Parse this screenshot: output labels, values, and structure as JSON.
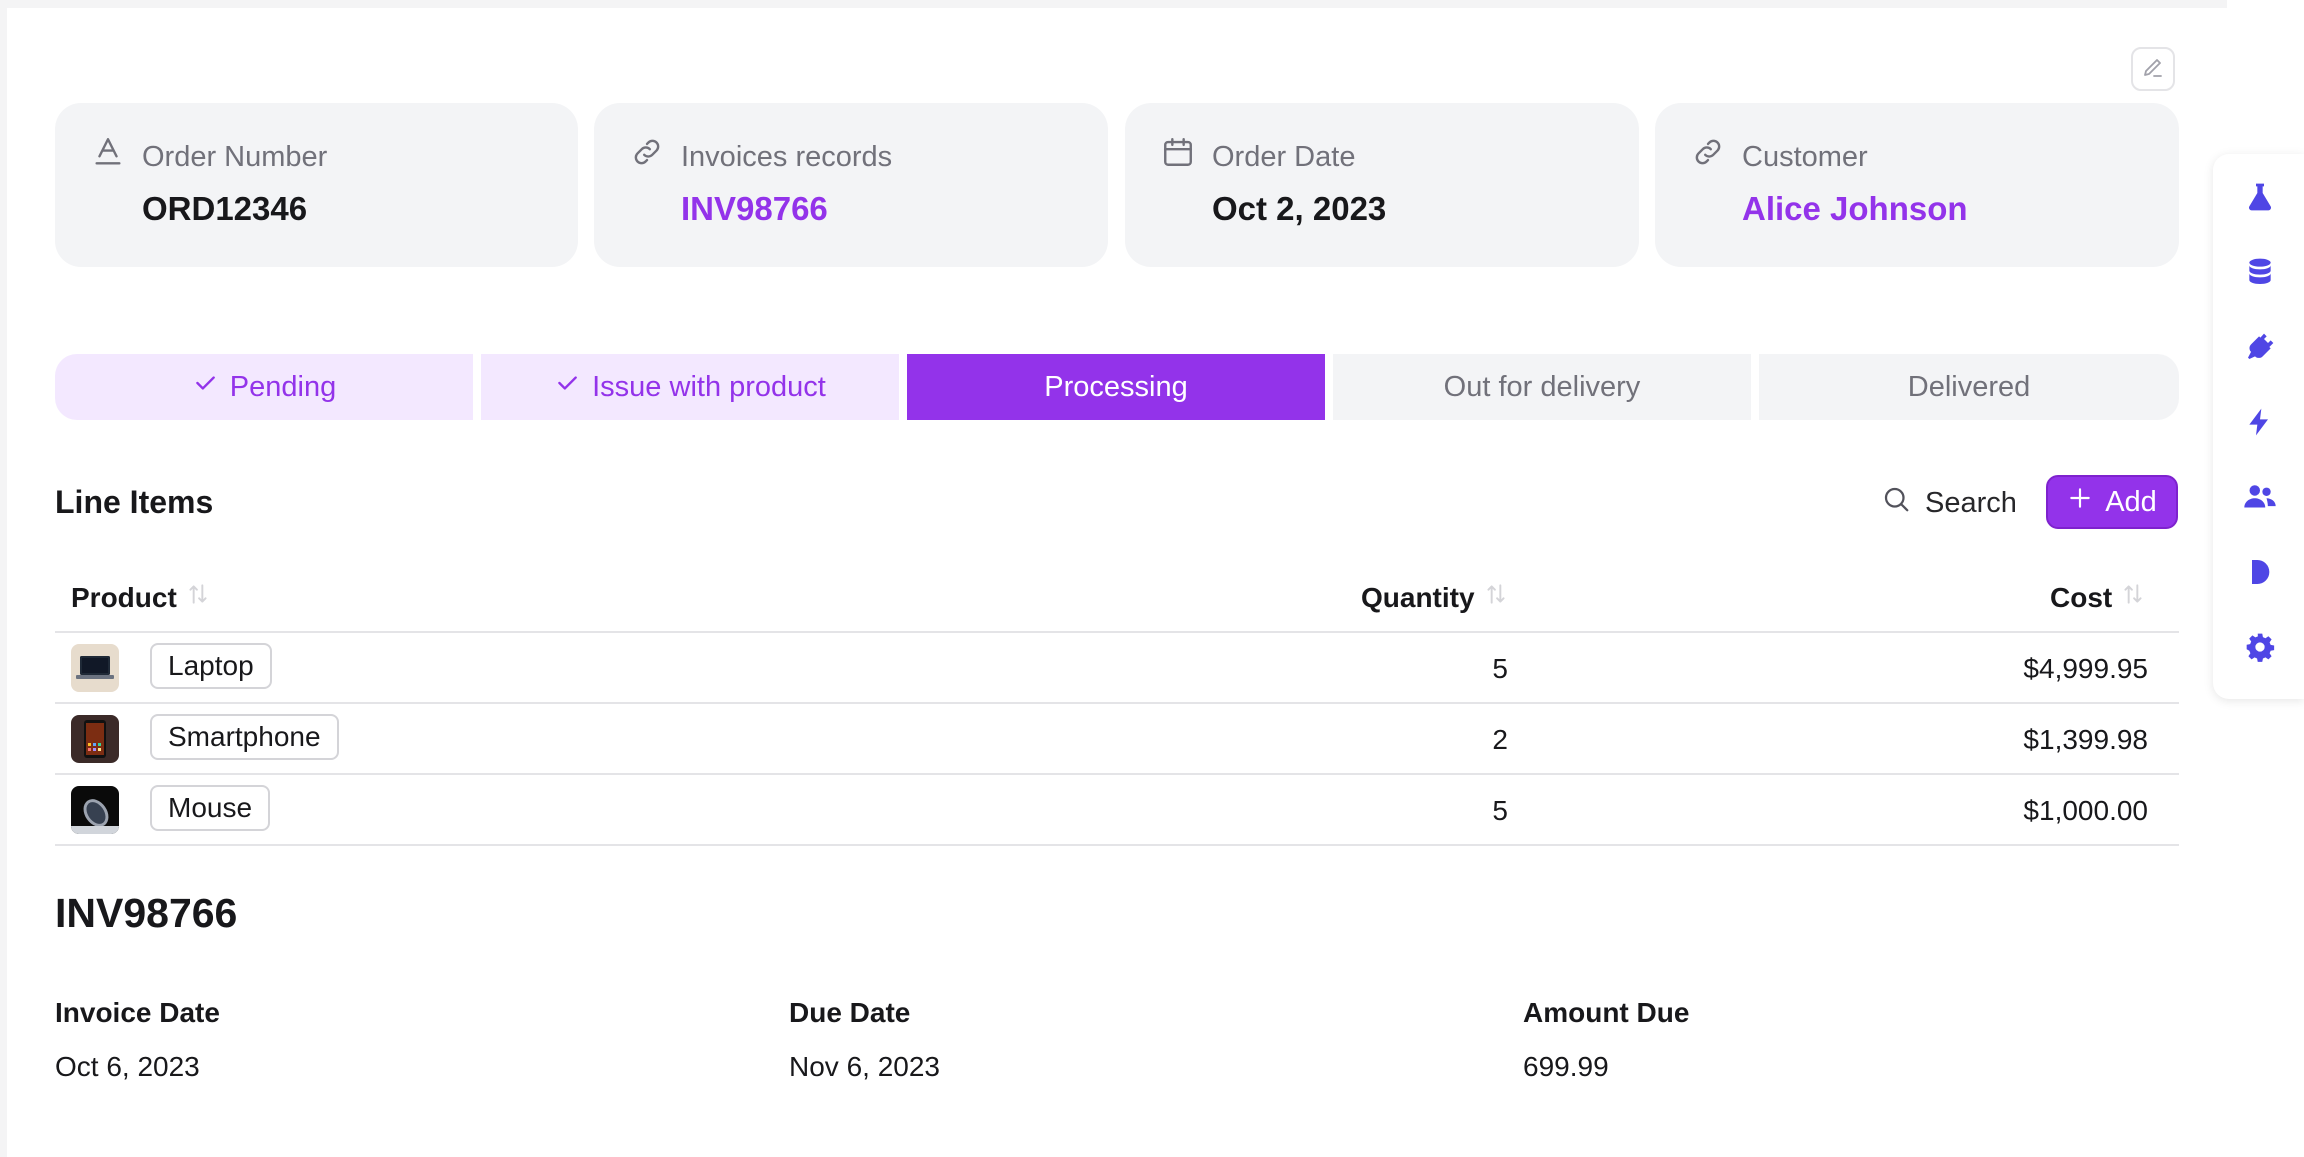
{
  "header_cards": [
    {
      "label": "Order Number",
      "value": "ORD12346",
      "icon": "text-icon",
      "is_link": false
    },
    {
      "label": "Invoices records",
      "value": "INV98766",
      "icon": "link-icon",
      "is_link": true
    },
    {
      "label": "Order Date",
      "value": "Oct 2, 2023",
      "icon": "calendar-icon",
      "is_link": false
    },
    {
      "label": "Customer",
      "value": "Alice Johnson",
      "icon": "link-icon",
      "is_link": true
    }
  ],
  "status_steps": [
    {
      "label": "Pending",
      "state": "done"
    },
    {
      "label": "Issue with product",
      "state": "done"
    },
    {
      "label": "Processing",
      "state": "active"
    },
    {
      "label": "Out for delivery",
      "state": "todo"
    },
    {
      "label": "Delivered",
      "state": "todo"
    }
  ],
  "line_items": {
    "title": "Line Items",
    "search_label": "Search",
    "add_label": "Add",
    "columns": [
      "Product",
      "Quantity",
      "Cost"
    ],
    "rows": [
      {
        "product": "Laptop",
        "quantity": "5",
        "cost": "$4,999.95"
      },
      {
        "product": "Smartphone",
        "quantity": "2",
        "cost": "$1,399.98"
      },
      {
        "product": "Mouse",
        "quantity": "5",
        "cost": "$1,000.00"
      }
    ]
  },
  "invoice": {
    "title": "INV98766",
    "fields": [
      {
        "label": "Invoice Date",
        "value": "Oct 6, 2023"
      },
      {
        "label": "Due Date",
        "value": "Nov 6, 2023"
      },
      {
        "label": "Amount Due",
        "value": "699.99"
      }
    ]
  },
  "sidebar_icons": [
    "flask-icon",
    "database-icon",
    "plug-icon",
    "bolt-icon",
    "users-icon",
    "play-icon",
    "gear-icon"
  ],
  "colors": {
    "accent": "#9333ea",
    "accent_light": "#f3e8ff",
    "card_bg": "#f3f4f6",
    "sidebar_icon": "#4f46e5"
  }
}
